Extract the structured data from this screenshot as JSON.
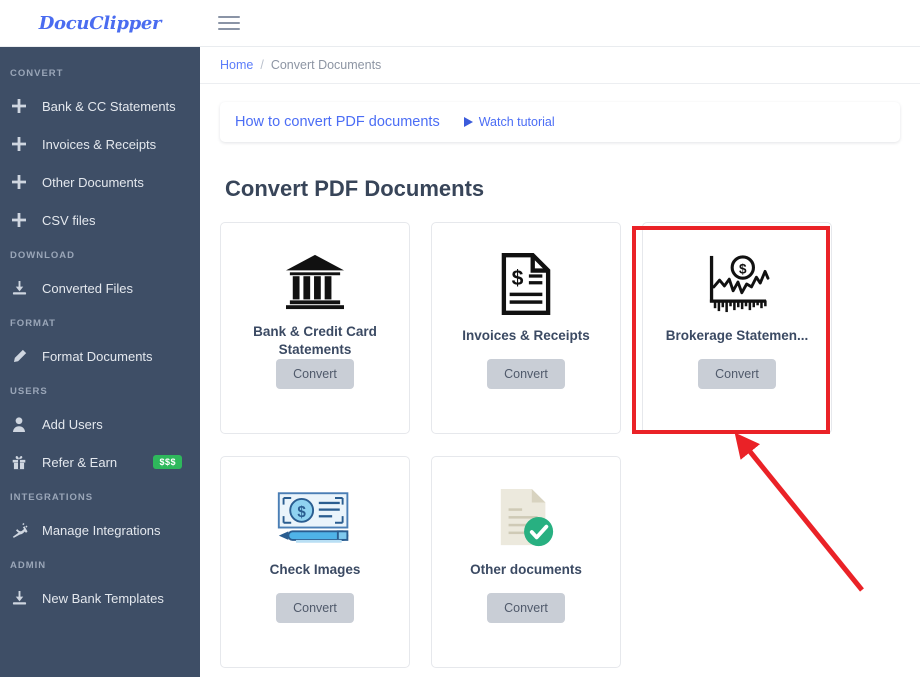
{
  "brand": {
    "logo_text": "DocuClipper"
  },
  "topbar": {
    "menu_icon": "hamburger-icon"
  },
  "breadcrumb": {
    "home": "Home",
    "separator": "/",
    "current": "Convert Documents"
  },
  "sidebar": {
    "sections": [
      {
        "title": "CONVERT",
        "items": [
          {
            "label": "Bank & CC Statements",
            "icon": "plus-icon"
          },
          {
            "label": "Invoices & Receipts",
            "icon": "plus-icon"
          },
          {
            "label": "Other Documents",
            "icon": "plus-icon"
          },
          {
            "label": "CSV files",
            "icon": "plus-icon"
          }
        ]
      },
      {
        "title": "DOWNLOAD",
        "items": [
          {
            "label": "Converted Files",
            "icon": "download-icon"
          }
        ]
      },
      {
        "title": "FORMAT",
        "items": [
          {
            "label": "Format Documents",
            "icon": "pencil-icon"
          }
        ]
      },
      {
        "title": "USERS",
        "items": [
          {
            "label": "Add Users",
            "icon": "user-icon"
          },
          {
            "label": "Refer & Earn",
            "icon": "gift-icon",
            "badge": "$$$"
          }
        ]
      },
      {
        "title": "INTEGRATIONS",
        "items": [
          {
            "label": "Manage Integrations",
            "icon": "plug-icon"
          }
        ]
      },
      {
        "title": "ADMIN",
        "items": [
          {
            "label": "New Bank Templates",
            "icon": "download-icon"
          }
        ]
      }
    ]
  },
  "tutorial": {
    "title": "How to convert PDF documents",
    "watch_label": "Watch tutorial",
    "play_icon": "play-icon"
  },
  "main": {
    "page_title": "Convert PDF Documents",
    "cards": [
      {
        "label": "Bank & Credit Card Statements",
        "button": "Convert",
        "icon": "bank-icon"
      },
      {
        "label": "Invoices & Receipts",
        "button": "Convert",
        "icon": "invoice-document-icon"
      },
      {
        "label": "Brokerage Statemen...",
        "button": "Convert",
        "icon": "stock-chart-dollar-icon"
      },
      {
        "label": "Check Images",
        "button": "Convert",
        "icon": "check-pen-icon"
      },
      {
        "label": "Other documents",
        "button": "Convert",
        "icon": "document-checkmark-icon"
      }
    ]
  },
  "annotation": {
    "highlight_color": "#ea2227",
    "highlight_target": "Brokerage Statemen...",
    "arrow": "pointer-arrow"
  },
  "colors": {
    "sidebar_bg": "#3e4e66",
    "accent_blue": "#4b6df5",
    "badge_green": "#2eb85c",
    "title_navy": "#384559",
    "button_gray": "#c9ced6",
    "annotation_red": "#ea2227"
  }
}
